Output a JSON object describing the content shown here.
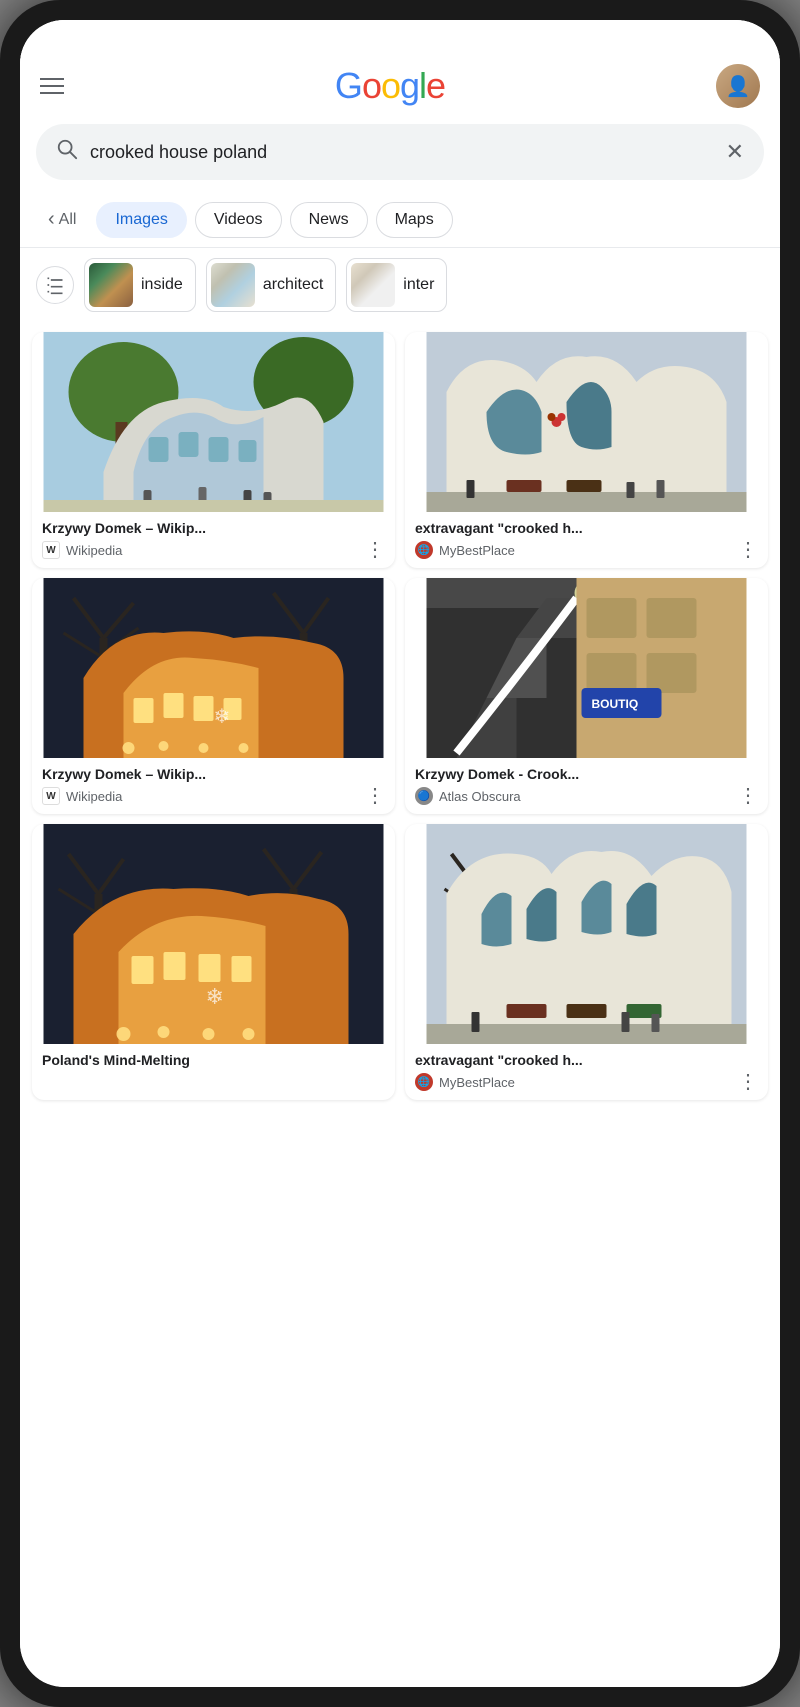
{
  "header": {
    "menu_label": "Menu",
    "google_letters": [
      "G",
      "o",
      "o",
      "g",
      "l",
      "e"
    ],
    "avatar_alt": "User profile"
  },
  "search": {
    "query": "crooked house poland",
    "placeholder": "Search",
    "clear_label": "Clear"
  },
  "tabs": [
    {
      "id": "all",
      "label": "All",
      "active": false
    },
    {
      "id": "images",
      "label": "Images",
      "active": true
    },
    {
      "id": "videos",
      "label": "Videos",
      "active": false
    },
    {
      "id": "news",
      "label": "News",
      "active": false
    },
    {
      "id": "maps",
      "label": "Maps",
      "active": false
    }
  ],
  "filter_chips": [
    {
      "id": "inside",
      "label": "inside"
    },
    {
      "id": "architect",
      "label": "architect"
    },
    {
      "id": "inter",
      "label": "inter"
    }
  ],
  "results": [
    {
      "id": "result-1",
      "title": "Krzywy Domek – Wikip...",
      "source": "Wikipedia",
      "source_type": "wikipedia"
    },
    {
      "id": "result-2",
      "title": "extravagant \"crooked h...",
      "source": "MyBestPlace",
      "source_type": "site"
    },
    {
      "id": "result-3",
      "title": "Krzywy Domek – Wikip...",
      "source": "Wikipedia",
      "source_type": "wikipedia"
    },
    {
      "id": "result-4",
      "title": "Krzywy Domek - Crook...",
      "source": "Atlas Obscura",
      "source_type": "site"
    },
    {
      "id": "result-5",
      "title": "Poland's Mind-Melting",
      "source": "",
      "source_type": "site"
    },
    {
      "id": "result-6",
      "title": "extravagant \"crooked h...",
      "source": "MyBestPlace",
      "source_type": "site"
    }
  ],
  "icons": {
    "hamburger": "☰",
    "search": "🔍",
    "close": "✕",
    "chevron_left": "‹",
    "more_vert": "⋮",
    "tune": "⊞"
  }
}
